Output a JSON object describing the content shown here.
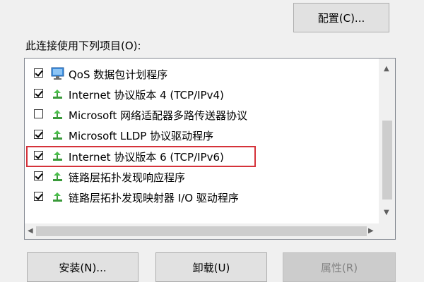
{
  "configure_button": "配置(C)...",
  "section_label": "此连接使用下列项目(O):",
  "items": [
    {
      "label": "QoS 数据包计划程序",
      "checked": true,
      "icon": "qos-monitor-icon"
    },
    {
      "label": "Internet 协议版本 4 (TCP/IPv4)",
      "checked": true,
      "icon": "protocol-icon"
    },
    {
      "label": "Microsoft 网络适配器多路传送器协议",
      "checked": false,
      "icon": "protocol-icon"
    },
    {
      "label": "Microsoft LLDP 协议驱动程序",
      "checked": true,
      "icon": "protocol-icon"
    },
    {
      "label": "Internet 协议版本 6 (TCP/IPv6)",
      "checked": true,
      "icon": "protocol-icon"
    },
    {
      "label": "链路层拓扑发现响应程序",
      "checked": true,
      "icon": "protocol-icon"
    },
    {
      "label": "链路层拓扑发现映射器 I/O 驱动程序",
      "checked": true,
      "icon": "protocol-icon"
    }
  ],
  "highlight_color": "#d5323a",
  "buttons": {
    "install": "安装(N)...",
    "uninstall": "卸载(U)",
    "properties": "属性(R)"
  }
}
